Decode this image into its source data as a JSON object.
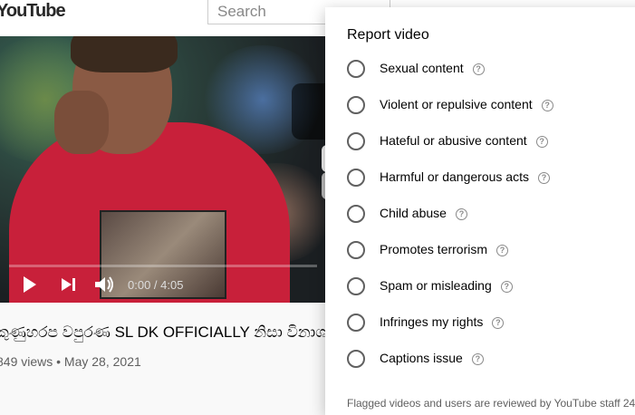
{
  "header": {
    "logo_text": "YouTube",
    "search_placeholder": "Search"
  },
  "player": {
    "time": "0:00 / 4:05",
    "play_icon": "play-icon",
    "next_icon": "skip-next-icon",
    "volume_icon": "volume-icon"
  },
  "video": {
    "title": "කුණුහරප වපුරණ SL DK OFFICIALLY නිසා විනාශවු",
    "meta": "849 views • May 28, 2021"
  },
  "dialog": {
    "title": "Report video",
    "options": [
      {
        "label": "Sexual content"
      },
      {
        "label": "Violent or repulsive content"
      },
      {
        "label": "Hateful or abusive content"
      },
      {
        "label": "Harmful or dangerous acts"
      },
      {
        "label": "Child abuse"
      },
      {
        "label": "Promotes terrorism"
      },
      {
        "label": "Spam or misleading"
      },
      {
        "label": "Infringes my rights"
      },
      {
        "label": "Captions issue"
      }
    ],
    "footnote": "Flagged videos and users are reviewed by YouTube staff 24"
  }
}
